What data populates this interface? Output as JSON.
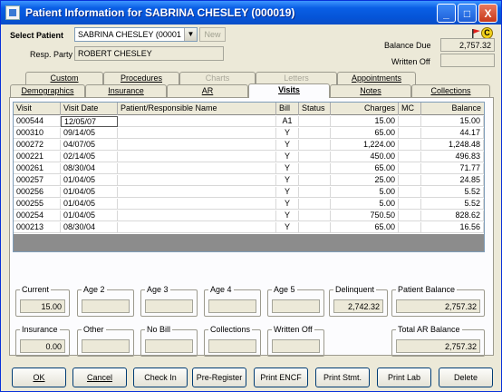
{
  "window": {
    "title": "Patient Information for SABRINA CHESLEY (000019)",
    "controls": [
      "_",
      "□",
      "X"
    ]
  },
  "header": {
    "select_patient_label": "Select Patient",
    "select_patient_value": "SABRINA CHESLEY (00001",
    "new_button": "New",
    "resp_party_label": "Resp. Party",
    "resp_party_value": "ROBERT CHESLEY",
    "balance_due_label": "Balance Due",
    "balance_due_value": "2,757.32",
    "written_off_label": "Written Off",
    "written_off_value": "",
    "badge_letter": "C"
  },
  "tabs_row1": [
    {
      "label": "Custom",
      "disabled": false
    },
    {
      "label": "Procedures",
      "disabled": false
    },
    {
      "label": "Charts",
      "disabled": true
    },
    {
      "label": "Letters",
      "disabled": true
    },
    {
      "label": "Appointments",
      "disabled": false
    }
  ],
  "tabs_row2": [
    {
      "label": "Demographics",
      "active": false
    },
    {
      "label": "Insurance",
      "active": false
    },
    {
      "label": "AR",
      "active": false
    },
    {
      "label": "Visits",
      "active": true
    },
    {
      "label": "Notes",
      "active": false
    },
    {
      "label": "Collections",
      "active": false
    }
  ],
  "grid": {
    "columns": [
      "Visit",
      "Visit Date",
      "Patient/Responsible Name",
      "Bill",
      "Status",
      "Charges",
      "MC",
      "Balance"
    ],
    "rows": [
      {
        "visit": "000544",
        "date": "12/05/07",
        "name": "",
        "bill": "A1",
        "status": "",
        "charges": "15.00",
        "mc": "",
        "balance": "15.00"
      },
      {
        "visit": "000310",
        "date": "09/14/05",
        "name": "",
        "bill": "Y",
        "status": "",
        "charges": "65.00",
        "mc": "",
        "balance": "44.17"
      },
      {
        "visit": "000272",
        "date": "04/07/05",
        "name": "",
        "bill": "Y",
        "status": "",
        "charges": "1,224.00",
        "mc": "",
        "balance": "1,248.48"
      },
      {
        "visit": "000221",
        "date": "02/14/05",
        "name": "",
        "bill": "Y",
        "status": "",
        "charges": "450.00",
        "mc": "",
        "balance": "496.83"
      },
      {
        "visit": "000261",
        "date": "08/30/04",
        "name": "",
        "bill": "Y",
        "status": "",
        "charges": "65.00",
        "mc": "",
        "balance": "71.77"
      },
      {
        "visit": "000257",
        "date": "01/04/05",
        "name": "",
        "bill": "Y",
        "status": "",
        "charges": "25.00",
        "mc": "",
        "balance": "24.85"
      },
      {
        "visit": "000256",
        "date": "01/04/05",
        "name": "",
        "bill": "Y",
        "status": "",
        "charges": "5.00",
        "mc": "",
        "balance": "5.52"
      },
      {
        "visit": "000255",
        "date": "01/04/05",
        "name": "",
        "bill": "Y",
        "status": "",
        "charges": "5.00",
        "mc": "",
        "balance": "5.52"
      },
      {
        "visit": "000254",
        "date": "01/04/05",
        "name": "",
        "bill": "Y",
        "status": "",
        "charges": "750.50",
        "mc": "",
        "balance": "828.62"
      },
      {
        "visit": "000213",
        "date": "08/30/04",
        "name": "",
        "bill": "Y",
        "status": "",
        "charges": "65.00",
        "mc": "",
        "balance": "16.56"
      }
    ]
  },
  "aging": {
    "current_label": "Current",
    "current_value": "15.00",
    "age2_label": "Age 2",
    "age2_value": "",
    "age3_label": "Age 3",
    "age3_value": "",
    "age4_label": "Age 4",
    "age4_value": "",
    "age5_label": "Age 5",
    "age5_value": "",
    "delinquent_label": "Delinquent",
    "delinquent_value": "2,742.32",
    "patient_balance_label": "Patient Balance",
    "patient_balance_value": "2,757.32",
    "insurance_label": "Insurance",
    "insurance_value": "0.00",
    "other_label": "Other",
    "other_value": "",
    "nobill_label": "No Bill",
    "nobill_value": "",
    "collections_label": "Collections",
    "collections_value": "",
    "writtenoff_label": "Written Off",
    "writtenoff_value": "",
    "total_ar_label": "Total AR Balance",
    "total_ar_value": "2,757.32"
  },
  "buttons": [
    "OK",
    "Cancel",
    "Check In",
    "Pre-Register",
    "Print ENCF",
    "Print Stmt.",
    "Print Lab",
    "Delete"
  ],
  "colors": {
    "titlebar": "#0554d8",
    "window_bg": "#ece9d8",
    "grid_empty": "#8c8c8c"
  }
}
